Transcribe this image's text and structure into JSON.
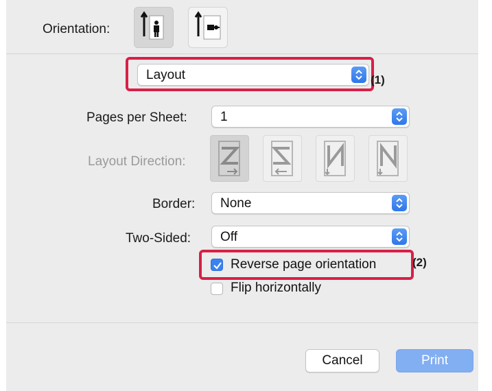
{
  "orientation": {
    "label": "Orientation:",
    "options": [
      {
        "icon": "portrait-orientation-icon",
        "selected": true
      },
      {
        "icon": "landscape-orientation-icon",
        "selected": false
      }
    ]
  },
  "section_popup": {
    "value": "Layout"
  },
  "pages_per_sheet": {
    "label": "Pages per Sheet:",
    "value": "1"
  },
  "layout_direction": {
    "label": "Layout Direction:",
    "enabled": false,
    "options": [
      {
        "icon": "z-left-to-right-icon",
        "selected": true
      },
      {
        "icon": "s-right-to-left-icon",
        "selected": false
      },
      {
        "icon": "n-reverse-top-to-bottom-icon",
        "selected": false
      },
      {
        "icon": "n-top-to-bottom-icon",
        "selected": false
      }
    ]
  },
  "border": {
    "label": "Border:",
    "value": "None"
  },
  "two_sided": {
    "label": "Two-Sided:",
    "value": "Off"
  },
  "reverse_page_orientation": {
    "label": "Reverse page orientation",
    "checked": true
  },
  "flip_horizontally": {
    "label": "Flip horizontally",
    "checked": false
  },
  "annotations": {
    "callout_1": "(1)",
    "callout_2": "(2)",
    "highlight_color": "#d81f47"
  },
  "buttons": {
    "cancel": "Cancel",
    "print": "Print"
  },
  "colors": {
    "accent": "#3b82f0",
    "print_button": "#82aef2",
    "dialog_bg": "#ececec"
  }
}
